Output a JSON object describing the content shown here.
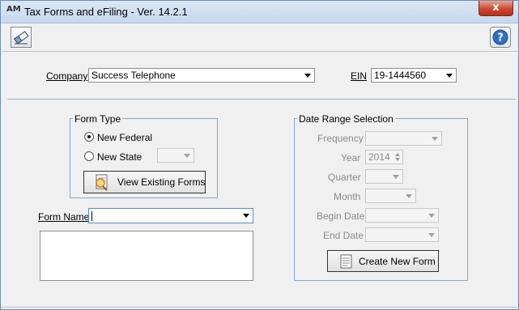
{
  "window": {
    "title": "Tax Forms and eFiling - Ver. 14.2.1",
    "close_label": "x",
    "app_icon_text": "AM"
  },
  "toolbar": {
    "left_icon": "eraser-icon",
    "help_icon": "help-icon",
    "help_label": "?"
  },
  "company": {
    "label": "Company",
    "value": "Success Telephone"
  },
  "ein": {
    "label": "EIN",
    "value": "19-1444560"
  },
  "form_type": {
    "legend": "Form Type",
    "new_federal_label": "New Federal",
    "new_federal_selected": true,
    "new_state_label": "New State",
    "new_state_selected": false,
    "state_value": "",
    "view_existing_label": "View Existing Forms"
  },
  "form_name": {
    "label": "Form Name",
    "value": ""
  },
  "date_range": {
    "legend": "Date Range Selection",
    "frequency_label": "Frequency",
    "frequency_value": "",
    "year_label": "Year",
    "year_value": "2014",
    "quarter_label": "Quarter",
    "quarter_value": "",
    "month_label": "Month",
    "month_value": "",
    "begin_date_label": "Begin Date",
    "begin_date_value": "",
    "end_date_label": "End Date",
    "end_date_value": "",
    "create_label": "Create New Form"
  },
  "colors": {
    "group_border": "#7eaad6",
    "close_button": "#c7432a"
  }
}
